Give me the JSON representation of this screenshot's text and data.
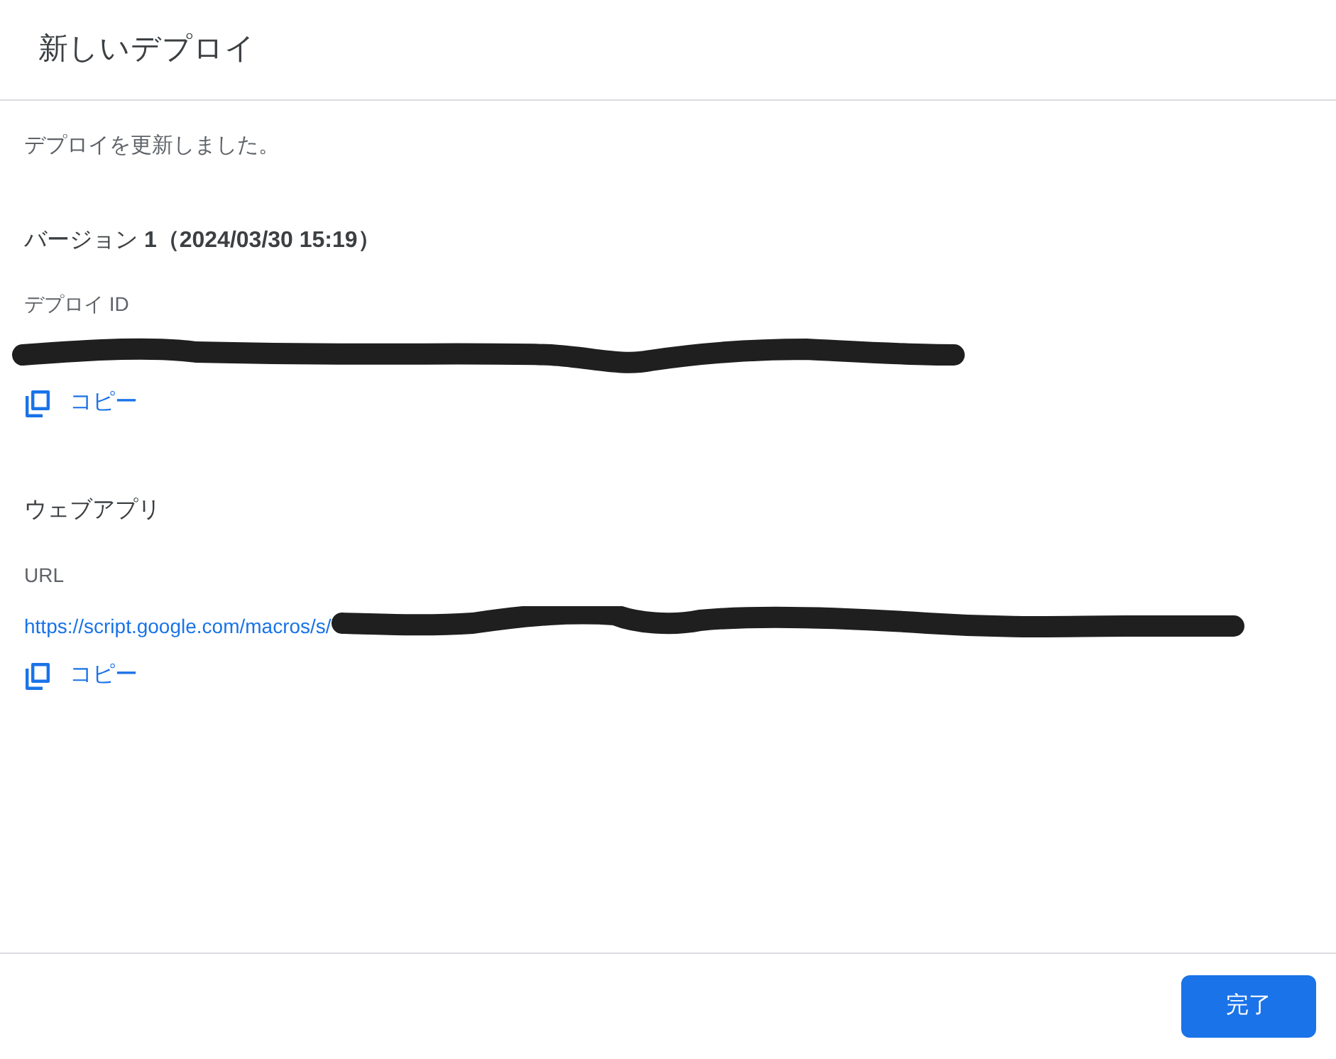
{
  "dialog": {
    "title": "新しいデプロイ"
  },
  "message": "デプロイを更新しました。",
  "version": "バージョン **1（2024/03/30 15:19）**",
  "deployment_id": {
    "label": "デプロイ ID",
    "redacted": true,
    "copy_link": "コピー"
  },
  "web_app": {
    "heading": "ウェブアプリ",
    "url_label": "URL",
    "url": "https://script.google.com/macros/s/",
    "redacted": true,
    "copy_link": "コピー"
  },
  "buttons": [
    {
      "label": "完了",
      "kind": "primary"
    }
  ]
}
